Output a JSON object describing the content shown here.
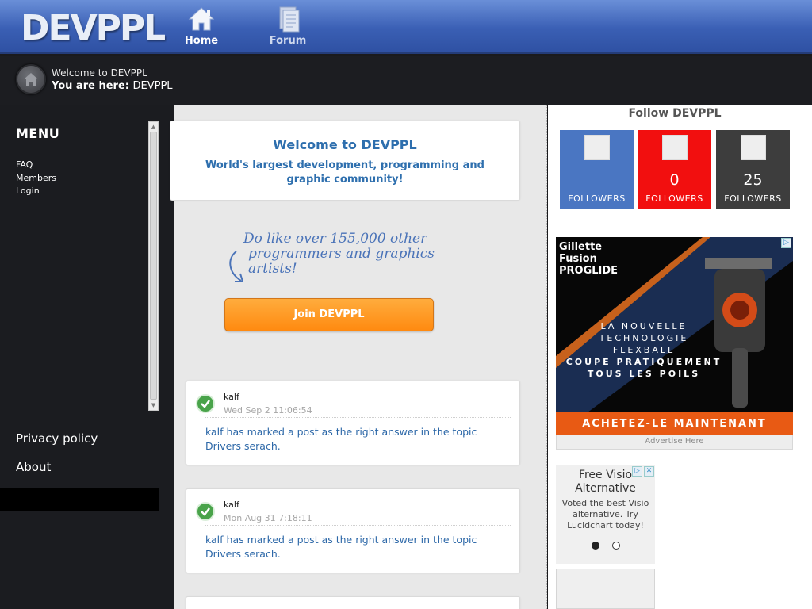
{
  "header": {
    "logo": "DEVPPL",
    "nav": [
      {
        "label": "Home",
        "icon": "home-icon"
      },
      {
        "label": "Forum",
        "icon": "forum-icon"
      }
    ]
  },
  "breadcrumb": {
    "welcome": "Welcome to DEVPPL",
    "here_label": "You are here:",
    "here_link": "DEVPPL"
  },
  "sidebar": {
    "menu_title": "MENU",
    "links": [
      "FAQ",
      "Members",
      "Login"
    ],
    "bottom_links": [
      "Privacy policy",
      "About"
    ]
  },
  "main": {
    "welcome_title": "Welcome to DEVPPL",
    "welcome_subtitle": "World's largest development, programming and graphic community!",
    "invite_line1": "Do like over 155,000 other",
    "invite_line2": "programmers and graphics artists!",
    "join_button": "Join DEVPPL",
    "activities": [
      {
        "user": "kalf",
        "time": "Wed Sep 2 11:06:54",
        "text": "kalf has marked a post as the right answer in the topic Drivers serach."
      },
      {
        "user": "kalf",
        "time": "Mon Aug 31 7:18:11",
        "text": "kalf has marked a post as the right answer in the topic Drivers serach."
      }
    ]
  },
  "right": {
    "follow_title": "Follow DEVPPL",
    "followers": [
      {
        "count": "",
        "label": "FOLLOWERS",
        "color": "#4a76c2"
      },
      {
        "count": "0",
        "label": "FOLLOWERS",
        "color": "#f20f0f"
      },
      {
        "count": "25",
        "label": "FOLLOWERS",
        "color": "#3d3d3d"
      }
    ],
    "ad": {
      "brand_line1": "Gillette",
      "brand_line2": "Fusion",
      "brand_line3": "PROGLIDE",
      "tag_line1": "LA NOUVELLE",
      "tag_line2": "TECHNOLOGIE",
      "tag_line3": "FLEXBALL",
      "tag_line4": "COUPE PRATIQUEMENT",
      "tag_line5": "TOUS LES POILS",
      "cta": "ACHETEZ-LE MAINTENANT",
      "advertise": "Advertise Here"
    },
    "ad2": {
      "title": "Free Visio Alternative",
      "text": "Voted the best Visio alternative. Try Lucidchart today!"
    }
  },
  "colors": {
    "header_blue": "#3a5fb4",
    "link_blue": "#2e6fae",
    "join_orange": "#ff8a10",
    "check_green": "#49a34a"
  }
}
